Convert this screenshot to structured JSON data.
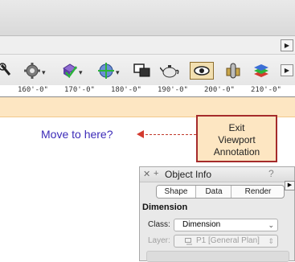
{
  "colors": {
    "annotation_band": "#fde6c2",
    "exit_border": "#a52b2b",
    "move_text": "#3c2bb8",
    "arrow": "#d33a2f"
  },
  "toolbar": {
    "icons": [
      "magnify-icon",
      "gear-icon",
      "3d-view-icon",
      "globe-icon",
      "layer-swap-icon",
      "teapot-icon",
      "eye-viewport-icon",
      "clip-icon",
      "layers-icon"
    ]
  },
  "ruler": {
    "ticks": [
      "160'-0\"",
      "170'-0\"",
      "180'-0\"",
      "190'-0\"",
      "200'-0\"",
      "210'-0\""
    ]
  },
  "canvas": {
    "move_label": "Move to here?",
    "exit_button": {
      "line1": "Exit",
      "line2": "Viewport",
      "line3": "Annotation"
    }
  },
  "object_info": {
    "title": "Object Info",
    "help": "?",
    "tabs": [
      "Shape",
      "Data",
      "Render"
    ],
    "selected_tab": "Shape",
    "section": "Dimension",
    "class_label": "Class:",
    "class_value": "Dimension",
    "layer_label": "Layer:",
    "layer_value": "P1 [General Plan]"
  }
}
